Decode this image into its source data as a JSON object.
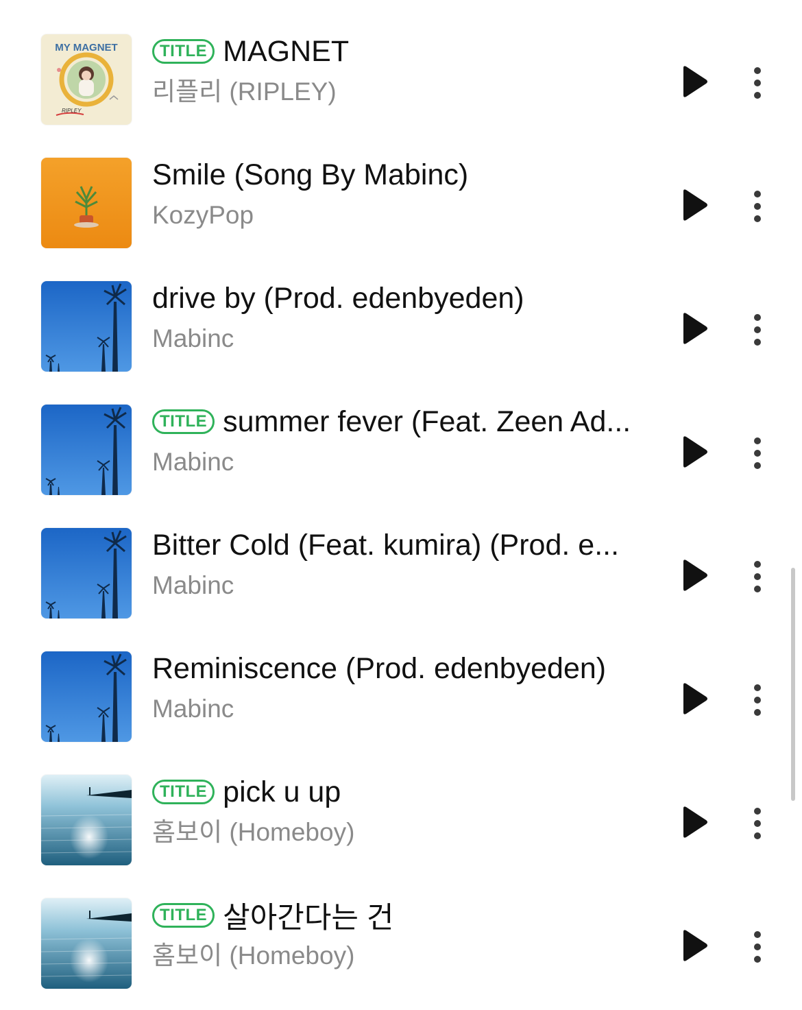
{
  "tracks": [
    {
      "badge": "TITLE",
      "title": "MAGNET",
      "artist": "리플리 (RIPLEY)",
      "art": "magnet-cover",
      "art_text": "MY MAGNET",
      "art_sign": "RIPLEY"
    },
    {
      "badge": "",
      "title": "Smile (Song By Mabinc)",
      "artist": "KozyPop",
      "art": "orange-plant-cover"
    },
    {
      "badge": "",
      "title": "drive by (Prod. edenbyeden)",
      "artist": "Mabinc",
      "art": "palm-tree-blue-sky-cover"
    },
    {
      "badge": "TITLE",
      "title": "summer fever (Feat. Zeen Ad...",
      "artist": "Mabinc",
      "art": "palm-tree-blue-sky-cover"
    },
    {
      "badge": "",
      "title": "Bitter Cold (Feat. kumira) (Prod. e...",
      "artist": "Mabinc",
      "art": "palm-tree-blue-sky-cover"
    },
    {
      "badge": "",
      "title": "Reminiscence (Prod. edenbyeden)",
      "artist": "Mabinc",
      "art": "palm-tree-blue-sky-cover"
    },
    {
      "badge": "TITLE",
      "title": "pick u up",
      "artist": "홈보이 (Homeboy)",
      "art": "sea-water-cover"
    },
    {
      "badge": "TITLE",
      "title": "살아간다는 건",
      "artist": "홈보이 (Homeboy)",
      "art": "sea-water-cover"
    }
  ],
  "icons": {
    "play": "play-icon",
    "more": "more-vertical-icon"
  },
  "colors": {
    "badge": "#2fb25a",
    "title": "#111111",
    "artist": "#8a8a8a",
    "icon": "#111111"
  }
}
